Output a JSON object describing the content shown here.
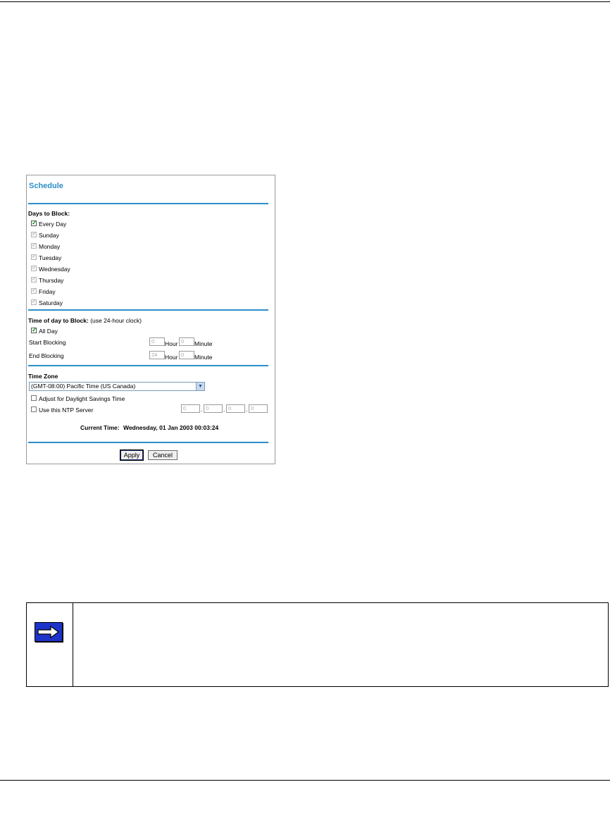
{
  "schedule": {
    "title": "Schedule",
    "days_section": "Days to Block:",
    "every_day": {
      "label": "Every Day",
      "checked": true
    },
    "days": [
      {
        "label": "Sunday",
        "checked": true,
        "disabled": true
      },
      {
        "label": "Monday",
        "checked": true,
        "disabled": true
      },
      {
        "label": "Tuesday",
        "checked": true,
        "disabled": true
      },
      {
        "label": "Wednesday",
        "checked": true,
        "disabled": true
      },
      {
        "label": "Thursday",
        "checked": true,
        "disabled": true
      },
      {
        "label": "Friday",
        "checked": true,
        "disabled": true
      },
      {
        "label": "Saturday",
        "checked": true,
        "disabled": true
      }
    ],
    "time_section": "Time of day to Block:",
    "time_note": "(use 24-hour clock)",
    "all_day": {
      "label": "All Day",
      "checked": true
    },
    "start_label": "Start Blocking",
    "start_hour": "0",
    "start_minute": "0",
    "end_label": "End Blocking",
    "end_hour": "24",
    "end_minute": "0",
    "hour_label": "Hour",
    "minute_label": "Minute",
    "tz_section": "Time Zone",
    "tz_selected": "(GMT-08:00) Pacific Time (US Canada)",
    "dst_label": "Adjust for Daylight Savings Time",
    "ntp_label": "Use this NTP Server",
    "ntp_octets": [
      "0",
      "0",
      "0",
      "0"
    ],
    "current_time_label": "Current Time:",
    "current_time_value": "Wednesday, 01 Jan 2003 00:03:24",
    "apply_label": "Apply",
    "cancel_label": "Cancel",
    "accent_color": "#2b8fc9"
  },
  "note": {
    "icon": "right-arrow-icon",
    "text": ""
  }
}
